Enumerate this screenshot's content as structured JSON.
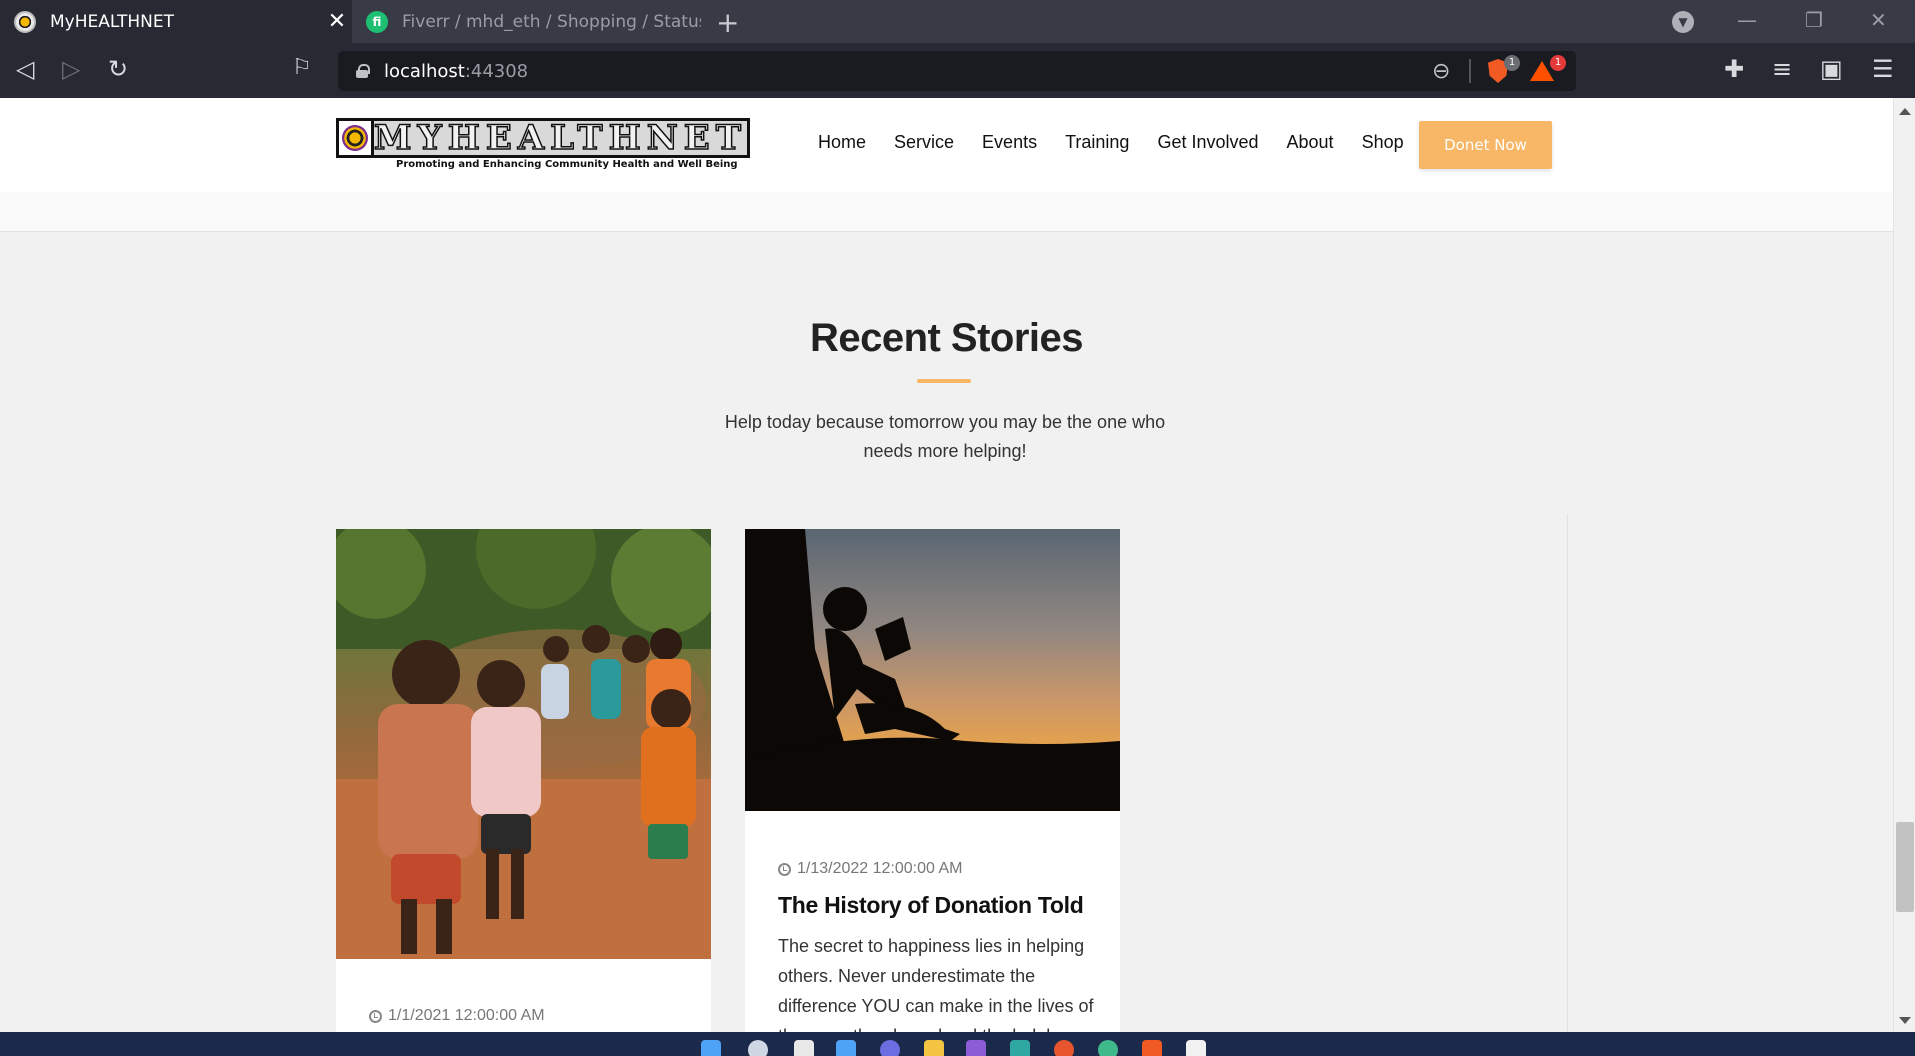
{
  "browser": {
    "tabs": [
      {
        "title": "MyHEALTHNET",
        "active": true
      },
      {
        "title": "Fiverr / mhd_eth / Shopping / Status c",
        "active": false
      }
    ],
    "new_tab_symbol": "+",
    "close_symbol": "✕",
    "url_host": "localhost",
    "url_port": ":44308",
    "brave_shield_count": "1",
    "rewards_count": "1",
    "icons": {
      "back": "back-arrow-icon",
      "forward": "forward-arrow-icon",
      "reload": "reload-icon",
      "bookmark": "bookmark-icon",
      "zoom": "zoom-out-icon",
      "extensions": "puzzle-icon",
      "playlist": "playlist-icon",
      "wallet": "wallet-icon",
      "menu": "hamburger-menu-icon"
    }
  },
  "site": {
    "logo_text": "MYHEALTHNET",
    "logo_tagline": "Promoting and Enhancing Community Health and Well Being",
    "nav": [
      "Home",
      "Service",
      "Events",
      "Training",
      "Get Involved",
      "About",
      "Shop"
    ],
    "donate_label": "Donet Now",
    "accent_color": "#f7b766"
  },
  "section": {
    "title": "Recent Stories",
    "subtitle": "Help today because tomorrow you may be the one who needs more helping!"
  },
  "stories": [
    {
      "date": "1/1/2021 12:00:00 AM",
      "title": "",
      "excerpt": ""
    },
    {
      "date": "1/13/2022 12:00:00 AM",
      "title": "The History of Donation Told",
      "excerpt": "The secret to happiness lies in helping others. Never underestimate the difference YOU can make in the lives of the poor, the abused and the helpless."
    }
  ]
}
